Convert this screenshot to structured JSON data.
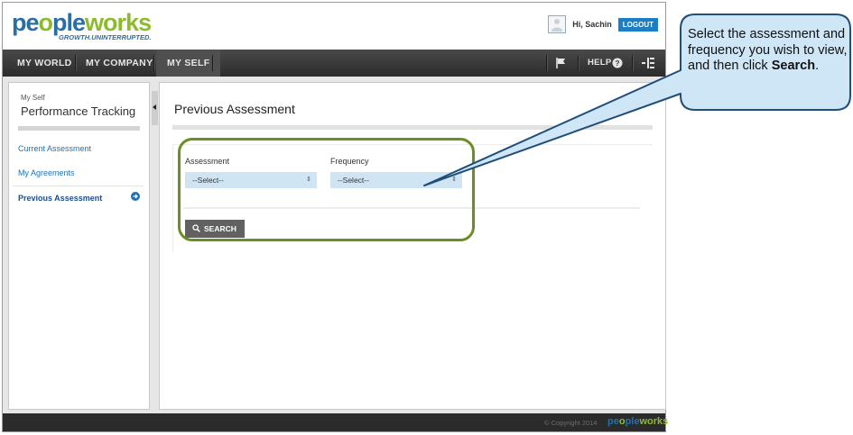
{
  "header": {
    "logo_text_1": "pe",
    "logo_text_2": "ple",
    "logo_text_3": "w",
    "logo_text_4": "rks",
    "tagline": "GROWTH.UNINTERRUPTED.",
    "greeting": "Hi, Sachin",
    "logout_label": "LOGOUT"
  },
  "nav": {
    "items": [
      {
        "label": "MY WORLD"
      },
      {
        "label": "MY COMPANY"
      },
      {
        "label": "MY SELF"
      }
    ],
    "help_label": "HELP"
  },
  "sidebar": {
    "section": "My Self",
    "title": "Performance Tracking",
    "links": [
      {
        "label": "Current Assessment"
      },
      {
        "label": "My Agreements"
      },
      {
        "label": "Previous Assessment"
      }
    ]
  },
  "main": {
    "title": "Previous Assessment",
    "assessment": {
      "label": "Assessment",
      "value": "--Select--"
    },
    "frequency": {
      "label": "Frequency",
      "value": "--Select--"
    },
    "search_label": "SEARCH"
  },
  "footer": {
    "copyright": "© Copyright 2014",
    "logo_text_1": "pe",
    "logo_text_2": "ple",
    "logo_text_3": "w",
    "logo_text_4": "rks"
  },
  "callout": {
    "text_before": "Select the assessment and frequency you wish to view, and then click ",
    "bold_word": "Search",
    "text_after": "."
  },
  "colors": {
    "accent_blue": "#1d7fc3",
    "brand_green": "#8dbb2e",
    "highlight_green": "#6b8e23",
    "callout_fill": "#cfe6f7",
    "callout_border": "#1f4e79"
  }
}
